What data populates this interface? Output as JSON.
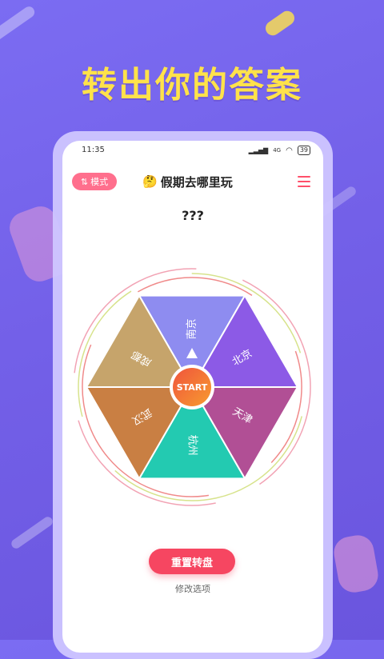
{
  "headline": "转出你的答案",
  "status_bar": {
    "time": "11:35",
    "signal": "4G",
    "battery": "39"
  },
  "toolbar": {
    "mode_label": "模式",
    "title": "假期去哪里玩",
    "title_emoji": "🤔"
  },
  "result_text": "???",
  "wheel": {
    "start_label": "START",
    "segments": [
      {
        "label": "南京",
        "color": "#8e8cf0"
      },
      {
        "label": "北京",
        "color": "#8c5ae6"
      },
      {
        "label": "天津",
        "color": "#b14f95"
      },
      {
        "label": "杭州",
        "color": "#23cab1"
      },
      {
        "label": "武汉",
        "color": "#c97f43"
      },
      {
        "label": "成都",
        "color": "#c6a46b"
      }
    ]
  },
  "actions": {
    "reset_label": "重置转盘",
    "edit_label": "修改选项"
  },
  "colors": {
    "accent": "#f64661",
    "background": "#7360e8",
    "headline": "#ffe24a"
  }
}
